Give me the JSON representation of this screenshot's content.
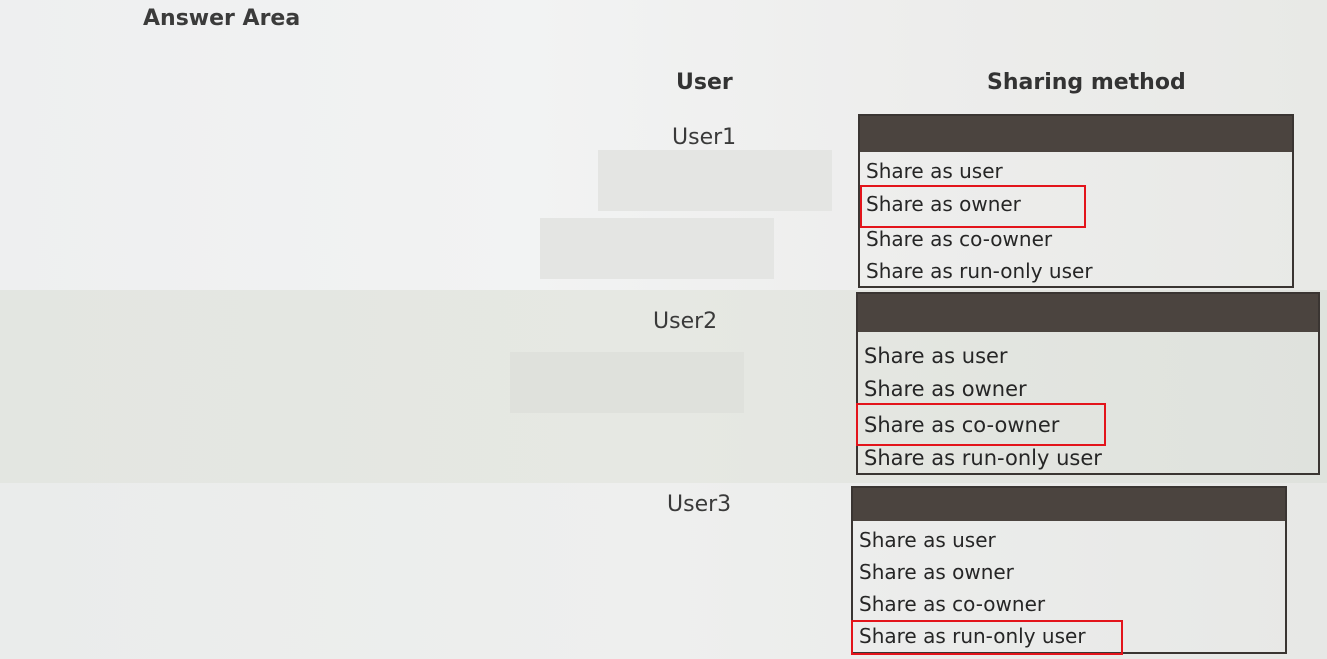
{
  "answer_area": {
    "title": "Answer Area"
  },
  "headers": {
    "user": "User",
    "method": "Sharing method"
  },
  "rows": [
    {
      "user": "User1",
      "options": [
        "Share as user",
        "Share as owner",
        "Share as co-owner",
        "Share as run-only user"
      ],
      "selected": "Share as owner"
    },
    {
      "user": "User2",
      "options": [
        "Share as user",
        "Share as owner",
        "Share as co-owner",
        "Share as run-only user"
      ],
      "selected": "Share as co-owner"
    },
    {
      "user": "User3",
      "options": [
        "Share as user",
        "Share as owner",
        "Share as co-owner",
        "Share as run-only user"
      ],
      "selected": "Share as run-only user"
    }
  ],
  "colors": {
    "selection_outline": "#e3141b",
    "dropdown_header": "#4b443f"
  }
}
